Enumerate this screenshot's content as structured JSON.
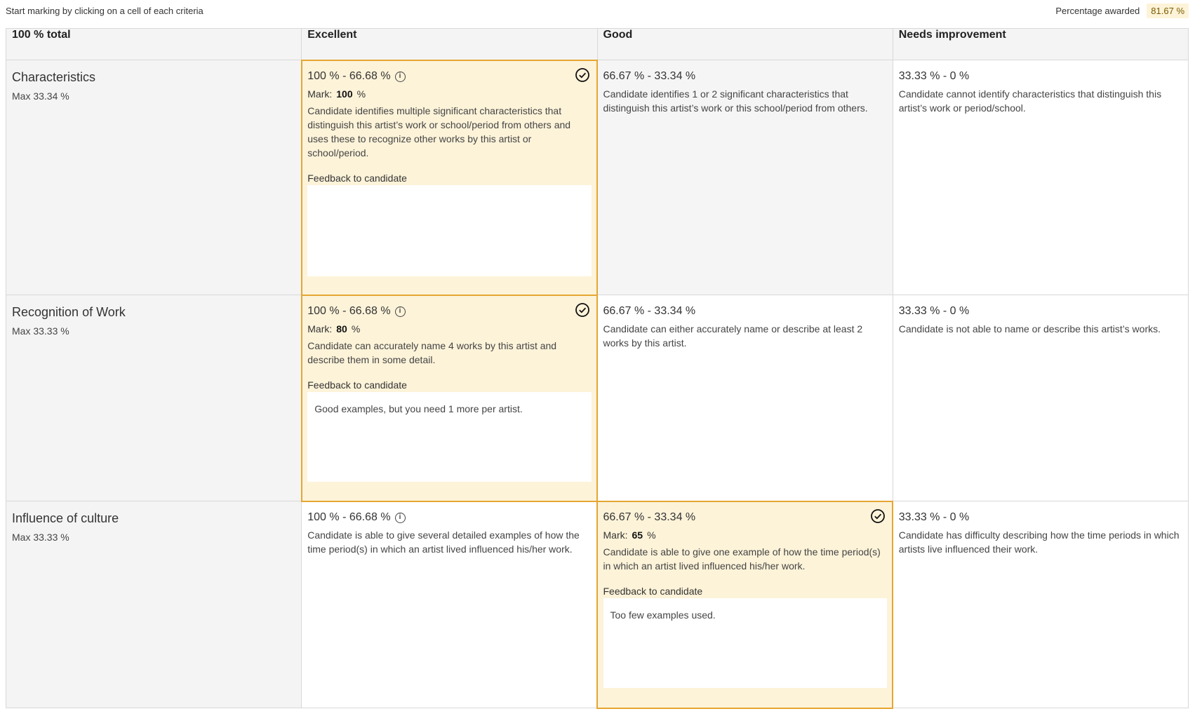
{
  "header": {
    "instruction": "Start marking by clicking on a cell of each criteria",
    "percentage_label": "Percentage awarded",
    "percentage_value": "81.67 %"
  },
  "columns": [
    "100 % total",
    "Excellent",
    "Good",
    "Needs improvement"
  ],
  "feedback_label": "Feedback to candidate",
  "mark_label": "Mark:",
  "mark_unit": "%",
  "colors": {
    "selected_bg": "#fdf3d9",
    "selected_border": "#e5a632",
    "shaded_bg": "#f5f5f5"
  },
  "criteria": [
    {
      "name": "Characteristics",
      "max": "Max 33.34 %",
      "levels": [
        {
          "range": "100 % - 66.68 %",
          "description": "Candidate identifies multiple significant characteristics that distinguish this artist’s work or school/period from others and uses these to recognize other works by this artist or school/period.",
          "selected": true,
          "mark": "100",
          "feedback": ""
        },
        {
          "range": "66.67 % - 33.34 %",
          "description": "Candidate identifies 1 or 2 significant characteristics that distinguish this artist’s work or this school/period from others."
        },
        {
          "range": "33.33 % - 0 %",
          "description": "Candidate cannot identify characteristics that distinguish this artist’s work or period/school."
        }
      ]
    },
    {
      "name": "Recognition of Work",
      "max": "Max 33.33 %",
      "levels": [
        {
          "range": "100 % - 66.68 %",
          "description": "Candidate can accurately name 4 works by this artist and describe them in some detail.",
          "selected": true,
          "mark": "80",
          "feedback": "Good examples, but you need 1 more per artist."
        },
        {
          "range": "66.67 % - 33.34 %",
          "description": "Candidate can either accurately name or describe at least 2 works by this artist."
        },
        {
          "range": "33.33 % - 0 %",
          "description": "Candidate is not able to name or describe this artist’s works."
        }
      ]
    },
    {
      "name": "Influence of culture",
      "max": "Max 33.33 %",
      "levels": [
        {
          "range": "100 % - 66.68 %",
          "description": "Candidate is able to give several detailed examples of how the time period(s) in which an artist lived influenced his/her work."
        },
        {
          "range": "66.67 % - 33.34 %",
          "description": "Candidate is able to give one example of how the time period(s) in which an artist lived influenced his/her work.",
          "selected": true,
          "mark": "65",
          "feedback": "Too few examples used."
        },
        {
          "range": "33.33 % - 0 %",
          "description": "Candidate has difficulty describing how the time periods in which artists live influenced their work."
        }
      ]
    }
  ]
}
